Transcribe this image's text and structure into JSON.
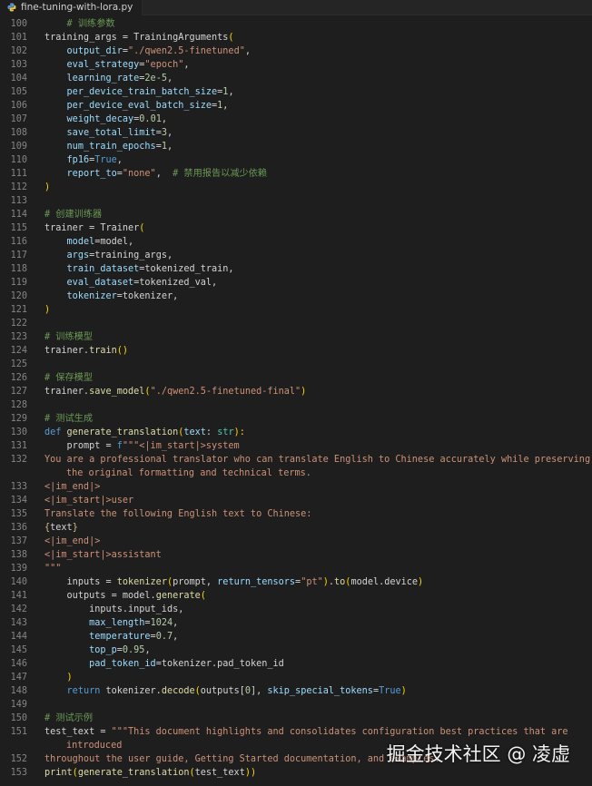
{
  "tab": {
    "filename": "fine-tuning-with-lora.py",
    "icon": "python-file-icon"
  },
  "watermark": "掘金技术社区 @ 凌虚",
  "colors": {
    "background": "#1e1e1e",
    "keyword": "#569cd6",
    "string": "#ce9178",
    "comment": "#6a9955",
    "param": "#9cdcfe",
    "number": "#b5cea8",
    "function": "#dcdcaa"
  },
  "lines": [
    {
      "num": "100",
      "tokens": [
        [
          "    ",
          ""
        ],
        [
          "# 训练参数",
          "c"
        ]
      ]
    },
    {
      "num": "101",
      "tokens": [
        [
          "training_args = TrainingArguments",
          ""
        ],
        [
          "(",
          "b"
        ]
      ]
    },
    {
      "num": "102",
      "tokens": [
        [
          "    ",
          ""
        ],
        [
          "output_dir",
          "p"
        ],
        [
          "=",
          ""
        ],
        [
          "\"./qwen2.5-finetuned\"",
          "s"
        ],
        [
          ",",
          ""
        ]
      ]
    },
    {
      "num": "103",
      "tokens": [
        [
          "    ",
          ""
        ],
        [
          "eval_strategy",
          "p"
        ],
        [
          "=",
          ""
        ],
        [
          "\"epoch\"",
          "s"
        ],
        [
          ",",
          ""
        ]
      ]
    },
    {
      "num": "104",
      "tokens": [
        [
          "    ",
          ""
        ],
        [
          "learning_rate",
          "p"
        ],
        [
          "=",
          ""
        ],
        [
          "2e-5",
          "n"
        ],
        [
          ",",
          ""
        ]
      ]
    },
    {
      "num": "105",
      "tokens": [
        [
          "    ",
          ""
        ],
        [
          "per_device_train_batch_size",
          "p"
        ],
        [
          "=",
          ""
        ],
        [
          "1",
          "n"
        ],
        [
          ",",
          ""
        ]
      ]
    },
    {
      "num": "106",
      "tokens": [
        [
          "    ",
          ""
        ],
        [
          "per_device_eval_batch_size",
          "p"
        ],
        [
          "=",
          ""
        ],
        [
          "1",
          "n"
        ],
        [
          ",",
          ""
        ]
      ]
    },
    {
      "num": "107",
      "tokens": [
        [
          "    ",
          ""
        ],
        [
          "weight_decay",
          "p"
        ],
        [
          "=",
          ""
        ],
        [
          "0.01",
          "n"
        ],
        [
          ",",
          ""
        ]
      ]
    },
    {
      "num": "108",
      "tokens": [
        [
          "    ",
          ""
        ],
        [
          "save_total_limit",
          "p"
        ],
        [
          "=",
          ""
        ],
        [
          "3",
          "n"
        ],
        [
          ",",
          ""
        ]
      ]
    },
    {
      "num": "109",
      "tokens": [
        [
          "    ",
          ""
        ],
        [
          "num_train_epochs",
          "p"
        ],
        [
          "=",
          ""
        ],
        [
          "1",
          "n"
        ],
        [
          ",",
          ""
        ]
      ]
    },
    {
      "num": "110",
      "tokens": [
        [
          "    ",
          ""
        ],
        [
          "fp16",
          "p"
        ],
        [
          "=",
          ""
        ],
        [
          "True",
          "k"
        ],
        [
          ",",
          ""
        ]
      ]
    },
    {
      "num": "111",
      "tokens": [
        [
          "    ",
          ""
        ],
        [
          "report_to",
          "p"
        ],
        [
          "=",
          ""
        ],
        [
          "\"none\"",
          "s"
        ],
        [
          ",  ",
          ""
        ],
        [
          "# 禁用报告以减少依赖",
          "c"
        ]
      ]
    },
    {
      "num": "112",
      "tokens": [
        [
          ")",
          "b"
        ]
      ]
    },
    {
      "num": "113",
      "tokens": []
    },
    {
      "num": "114",
      "tokens": [
        [
          "# 创建训练器",
          "c"
        ]
      ]
    },
    {
      "num": "115",
      "tokens": [
        [
          "trainer = Trainer",
          ""
        ],
        [
          "(",
          "b"
        ]
      ]
    },
    {
      "num": "116",
      "tokens": [
        [
          "    ",
          ""
        ],
        [
          "model",
          "p"
        ],
        [
          "=model,",
          ""
        ]
      ]
    },
    {
      "num": "117",
      "tokens": [
        [
          "    ",
          ""
        ],
        [
          "args",
          "p"
        ],
        [
          "=training_args,",
          ""
        ]
      ]
    },
    {
      "num": "118",
      "tokens": [
        [
          "    ",
          ""
        ],
        [
          "train_dataset",
          "p"
        ],
        [
          "=tokenized_train,",
          ""
        ]
      ]
    },
    {
      "num": "119",
      "tokens": [
        [
          "    ",
          ""
        ],
        [
          "eval_dataset",
          "p"
        ],
        [
          "=tokenized_val,",
          ""
        ]
      ]
    },
    {
      "num": "120",
      "tokens": [
        [
          "    ",
          ""
        ],
        [
          "tokenizer",
          "p"
        ],
        [
          "=tokenizer,",
          ""
        ]
      ]
    },
    {
      "num": "121",
      "tokens": [
        [
          ")",
          "b"
        ]
      ]
    },
    {
      "num": "122",
      "tokens": []
    },
    {
      "num": "123",
      "tokens": [
        [
          "# 训练模型",
          "c"
        ]
      ]
    },
    {
      "num": "124",
      "tokens": [
        [
          "trainer.",
          ""
        ],
        [
          "train",
          "f"
        ],
        [
          "()",
          "b"
        ]
      ]
    },
    {
      "num": "125",
      "tokens": []
    },
    {
      "num": "126",
      "tokens": [
        [
          "# 保存模型",
          "c"
        ]
      ]
    },
    {
      "num": "127",
      "tokens": [
        [
          "trainer.",
          ""
        ],
        [
          "save_model",
          "f"
        ],
        [
          "(",
          "b"
        ],
        [
          "\"./qwen2.5-finetuned-final\"",
          "s"
        ],
        [
          ")",
          "b"
        ]
      ]
    },
    {
      "num": "128",
      "tokens": []
    },
    {
      "num": "129",
      "tokens": [
        [
          "# 测试生成",
          "c"
        ]
      ]
    },
    {
      "num": "130",
      "tokens": [
        [
          "def ",
          "k"
        ],
        [
          "generate_translation",
          "f"
        ],
        [
          "(",
          "b"
        ],
        [
          "text",
          "p"
        ],
        [
          ": ",
          ""
        ],
        [
          "str",
          "t"
        ],
        [
          "):",
          "b"
        ]
      ]
    },
    {
      "num": "131",
      "tokens": [
        [
          "    ",
          ""
        ],
        [
          "prompt = ",
          ""
        ],
        [
          "f",
          "k"
        ],
        [
          "\"\"\"<|im_start|>system",
          "s"
        ]
      ]
    },
    {
      "num": "132",
      "tokens": [
        [
          "You are a professional translator who can translate English to Chinese accurately while preserving",
          "s"
        ]
      ],
      "wrap": "the original formatting and technical terms."
    },
    {
      "num": "133",
      "tokens": [
        [
          "<|im_end|>",
          "s"
        ]
      ]
    },
    {
      "num": "134",
      "tokens": [
        [
          "<|im_start|>user",
          "s"
        ]
      ]
    },
    {
      "num": "135",
      "tokens": [
        [
          "Translate the following English text to Chinese:",
          "s"
        ]
      ]
    },
    {
      "num": "136",
      "tokens": [
        [
          "{",
          "e"
        ],
        [
          "text",
          ""
        ],
        [
          "}",
          "e"
        ]
      ]
    },
    {
      "num": "137",
      "tokens": [
        [
          "<|im_end|>",
          "s"
        ]
      ]
    },
    {
      "num": "138",
      "tokens": [
        [
          "<|im_start|>assistant",
          "s"
        ]
      ]
    },
    {
      "num": "139",
      "tokens": [
        [
          "\"\"\"",
          "s"
        ]
      ]
    },
    {
      "num": "140",
      "tokens": [
        [
          "    ",
          ""
        ],
        [
          "inputs = ",
          ""
        ],
        [
          "tokenizer",
          "f"
        ],
        [
          "(",
          "b"
        ],
        [
          "prompt, ",
          ""
        ],
        [
          "return_tensors",
          "p"
        ],
        [
          "=",
          ""
        ],
        [
          "\"pt\"",
          "s"
        ],
        [
          ")",
          "b"
        ],
        [
          ".",
          ""
        ],
        [
          "to",
          "f"
        ],
        [
          "(",
          "b"
        ],
        [
          "model.device",
          ""
        ],
        [
          ")",
          "b"
        ]
      ]
    },
    {
      "num": "141",
      "tokens": [
        [
          "    ",
          ""
        ],
        [
          "outputs = model.",
          ""
        ],
        [
          "generate",
          "f"
        ],
        [
          "(",
          "b"
        ]
      ]
    },
    {
      "num": "142",
      "tokens": [
        [
          "        ",
          ""
        ],
        [
          "inputs.input_ids,",
          ""
        ]
      ]
    },
    {
      "num": "143",
      "tokens": [
        [
          "        ",
          ""
        ],
        [
          "max_length",
          "p"
        ],
        [
          "=",
          ""
        ],
        [
          "1024",
          "n"
        ],
        [
          ",",
          ""
        ]
      ]
    },
    {
      "num": "144",
      "tokens": [
        [
          "        ",
          ""
        ],
        [
          "temperature",
          "p"
        ],
        [
          "=",
          ""
        ],
        [
          "0.7",
          "n"
        ],
        [
          ",",
          ""
        ]
      ]
    },
    {
      "num": "145",
      "tokens": [
        [
          "        ",
          ""
        ],
        [
          "top_p",
          "p"
        ],
        [
          "=",
          ""
        ],
        [
          "0.95",
          "n"
        ],
        [
          ",",
          ""
        ]
      ]
    },
    {
      "num": "146",
      "tokens": [
        [
          "        ",
          ""
        ],
        [
          "pad_token_id",
          "p"
        ],
        [
          "=tokenizer.pad_token_id",
          ""
        ]
      ]
    },
    {
      "num": "147",
      "tokens": [
        [
          "    ",
          ""
        ],
        [
          ")",
          "b"
        ]
      ]
    },
    {
      "num": "148",
      "tokens": [
        [
          "    ",
          ""
        ],
        [
          "return ",
          "k"
        ],
        [
          "tokenizer.",
          ""
        ],
        [
          "decode",
          "f"
        ],
        [
          "(",
          "b"
        ],
        [
          "outputs[",
          ""
        ],
        [
          "0",
          "n"
        ],
        [
          "], ",
          ""
        ],
        [
          "skip_special_tokens",
          "p"
        ],
        [
          "=",
          ""
        ],
        [
          "True",
          "k"
        ],
        [
          ")",
          "b"
        ]
      ]
    },
    {
      "num": "149",
      "tokens": []
    },
    {
      "num": "150",
      "tokens": [
        [
          "# 测试示例",
          "c"
        ]
      ]
    },
    {
      "num": "151",
      "tokens": [
        [
          "test_text = ",
          ""
        ],
        [
          "\"\"\"This document highlights and consolidates configuration best practices that are",
          "s"
        ]
      ],
      "wrap": "introduced"
    },
    {
      "num": "152",
      "tokens": [
        [
          "throughout the user guide, Getting Started documentation, and examples.",
          "s"
        ]
      ]
    },
    {
      "num": "153",
      "tokens": [
        [
          "print",
          "f"
        ],
        [
          "(",
          "b"
        ],
        [
          "generate_translation",
          "f"
        ],
        [
          "(",
          "b"
        ],
        [
          "test_text",
          ""
        ],
        [
          "))",
          "b"
        ]
      ]
    }
  ]
}
